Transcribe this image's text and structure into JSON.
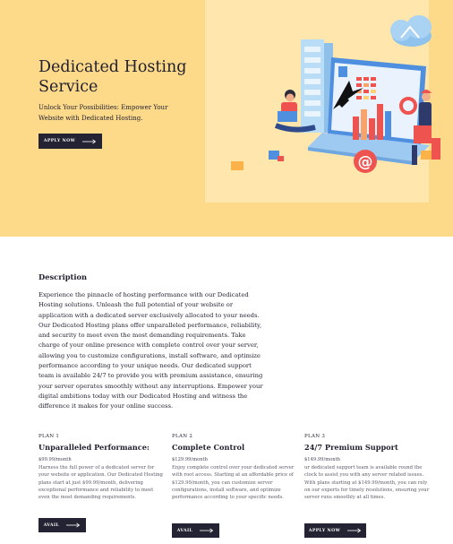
{
  "hero": {
    "title": "Dedicated Hosting Service",
    "subtitle": "Unlock Your Possibilities: Empower Your Website with Dedicated Hosting.",
    "cta_label": "APPLY NOW"
  },
  "description": {
    "heading": "Description",
    "body": "Experience the pinnacle of hosting performance with our Dedicated Hosting solutions. Unleash the full potential of your website or application with a dedicated server exclusively allocated to your needs. Our Dedicated Hosting plans offer unparalleled performance, reliability, and security to meet even the most demanding requirements. Take charge of your online presence with complete control over your server, allowing you to customize configurations, install software, and optimize performance according to your unique needs. Our dedicated support team is available 24/7 to provide you with premium assistance, ensuring your server operates smoothly without any interruptions. Empower your digital ambitions today with our Dedicated Hosting and witness the difference it makes for your online success."
  },
  "plans": [
    {
      "number": "PLAN 1",
      "title": "Unparalleled Performance:",
      "price": "$99.99/month",
      "text": "Harness the full power of a dedicated server for your website or application. Our Dedicated Hosting plans start at just $99.99/month, delivering exceptional performance and reliability to meet even the most demanding requirements.",
      "button": "AVAIL"
    },
    {
      "number": "PLAN 2",
      "title": "Complete Control",
      "price": "$129.99/month",
      "text": "Enjoy complete control over your dedicated server with root access. Starting at an affordable price of $129.99/month, you can customize server configurations, install software, and optimize performance according to your specific needs.",
      "button": "AVAIL"
    },
    {
      "number": "PLAN 3",
      "title": "24/7 Premium Support",
      "price": "$149.99/month",
      "text": "ur dedicated support team is available round the clock to assist you with any server related issues. With plans starting at $149.99/month, you can rely on our experts for timely resolutions, ensuring your server runs smoothly at all times.",
      "button": "APPLY NOW"
    }
  ],
  "icons": {
    "arrow": "right-arrow-icon",
    "illustration": "hosting-illustration"
  },
  "colors": {
    "hero_bg": "#fdd98a",
    "hero_panel": "#fee6ad",
    "button_bg": "#232333",
    "accent_red": "#ef5350",
    "accent_blue": "#4f8fe0"
  }
}
